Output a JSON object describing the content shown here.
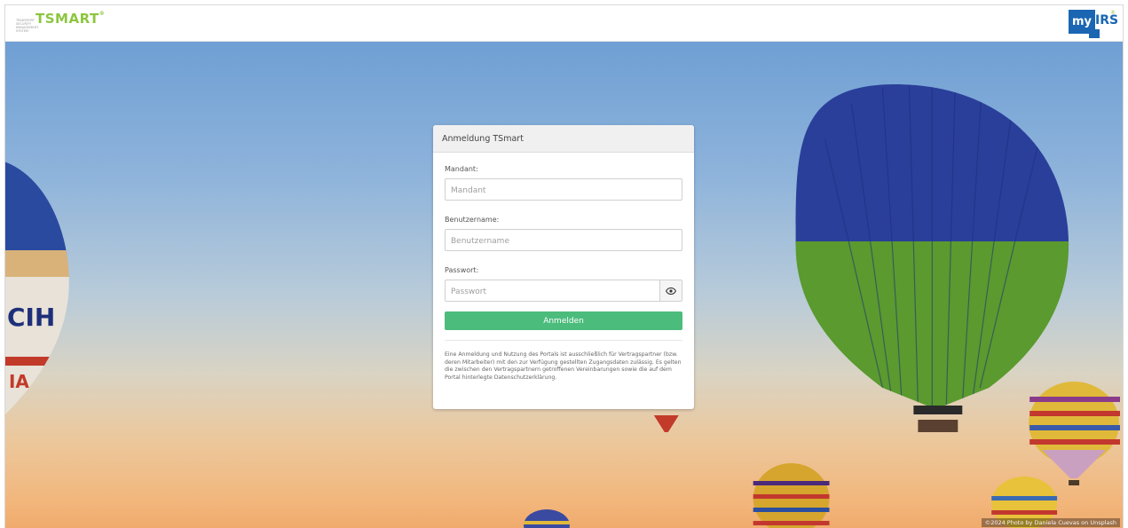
{
  "header": {
    "left_logo": {
      "word": "TSMART",
      "trademark": "®",
      "tagline": "TRANSPORT SECURITY MANAGEMENT SYSTEM"
    },
    "right_logo": {
      "my": "my",
      "irs": "IRS",
      "trademark": "®",
      "brand_color": "#1a66b3"
    }
  },
  "login": {
    "title": "Anmeldung TSmart",
    "mandant": {
      "label": "Mandant:",
      "placeholder": "Mandant",
      "value": ""
    },
    "username": {
      "label": "Benutzername:",
      "placeholder": "Benutzername",
      "value": ""
    },
    "password": {
      "label": "Passwort:",
      "placeholder": "Passwort",
      "value": "",
      "toggle_icon": "eye-icon"
    },
    "submit_label": "Anmelden",
    "notice": "Eine Anmeldung und Nutzung des Portals ist ausschließlich für Vertragspartner (bzw. deren Mitarbeiter) mit den zur Verfügung gestellten Zugangsdaten zulässig. Es gelten die zwischen den Vertragspartnern getroffenen Vereinbarungen sowie die auf dem Portal hinterlegte Datenschutzerklärung."
  },
  "background": {
    "photo_credit": "©2024 Photo by Daniela Cuevas on Unsplash"
  },
  "colors": {
    "accent_green": "#4cbc7c",
    "logo_green": "#8cc63f",
    "logo_blue": "#1a66b3"
  }
}
